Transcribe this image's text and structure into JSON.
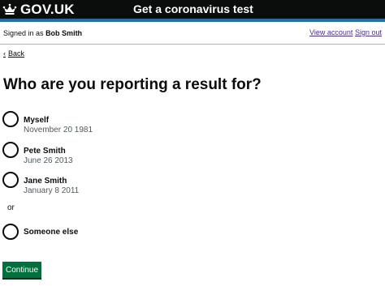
{
  "header": {
    "logo_text": "GOV.UK",
    "service_name": "Get a coronavirus test"
  },
  "account": {
    "signed_in_prefix": "Signed in as",
    "user_name": "Bob Smith",
    "view_account": "View account",
    "sign_out": "Sign out"
  },
  "back_link": "Back",
  "heading": "Who are you reporting a result for?",
  "options": [
    {
      "label": "Myself",
      "hint": "November 20 1981"
    },
    {
      "label": "Pete Smith",
      "hint": "June 26 2013"
    },
    {
      "label": "Jane Smith",
      "hint": "January 8 2011"
    },
    {
      "label": "Someone else",
      "hint": ""
    }
  ],
  "divider": "or",
  "continue_label": "Continue",
  "colors": {
    "header": "#0b0c0c",
    "header_accent": "#1d70b8",
    "button": "#00703c",
    "visited_link": "#4c2c92"
  }
}
